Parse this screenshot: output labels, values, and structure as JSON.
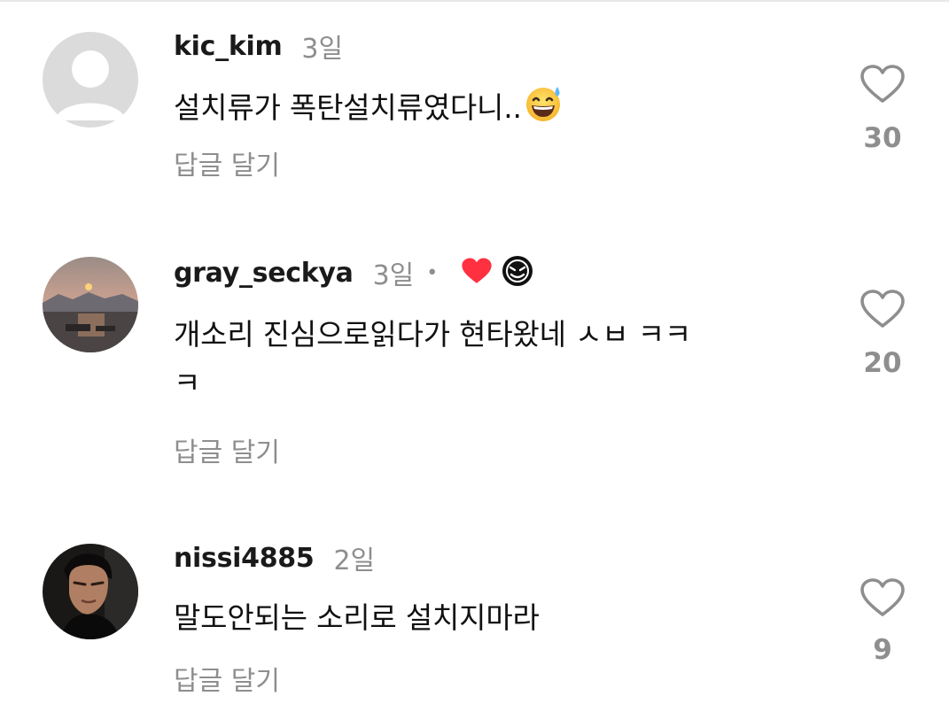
{
  "comments": [
    {
      "username": "kic_kim",
      "time": "3일",
      "text": "설치류가 폭탄설치류였다니..",
      "emoji": "grinning-sweat-emoji",
      "reply": "답글 달기",
      "likes": "30",
      "avatar": "default-avatar-icon"
    },
    {
      "username": "gray_seckya",
      "time": "3일",
      "separator": "•",
      "liked_by_creator": true,
      "text_line1": "개소리 진심으로읽다가 현타왔네 ㅅㅂ ㅋㅋ",
      "text_line2": "ㅋ",
      "reply": "답글 달기",
      "likes": "20",
      "avatar": "sunset-photo-avatar"
    },
    {
      "username": "nissi4885",
      "time": "2일",
      "text": "말도안되는 소리로 설치지마라",
      "reply": "답글 달기",
      "likes": "9",
      "avatar": "portrait-photo-avatar"
    }
  ],
  "colors": {
    "secondary_text": "#8e8e8e",
    "primary_text": "#111111",
    "heart_red": "#ff3040",
    "heart_outline": "#8e8e8e"
  }
}
